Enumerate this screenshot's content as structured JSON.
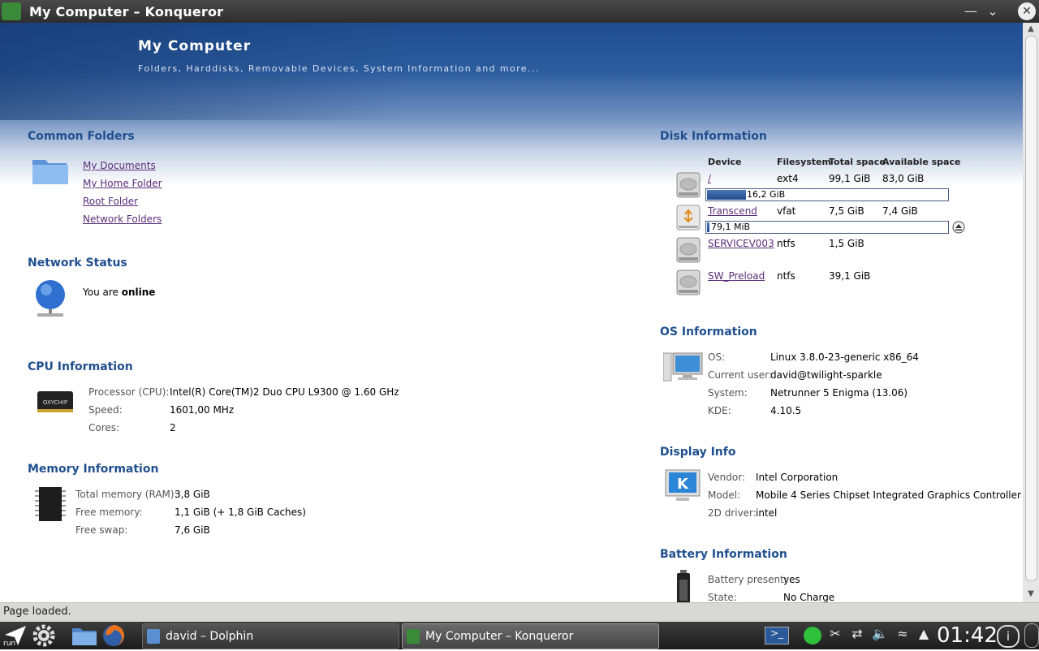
{
  "window": {
    "title": "My Computer – Konqueror"
  },
  "header": {
    "title": "My Computer",
    "subtitle": "Folders, Harddisks, Removable Devices, System Information and more..."
  },
  "common_folders": {
    "heading": "Common Folders",
    "links": [
      "My Documents",
      "My Home Folder",
      "Root Folder",
      "Network Folders"
    ]
  },
  "network": {
    "heading": "Network Status",
    "text_prefix": "You are",
    "status": "online"
  },
  "cpu": {
    "heading": "CPU Information",
    "rows": [
      {
        "label": "Processor (CPU):",
        "value": "Intel(R) Core(TM)2 Duo CPU L9300 @ 1.60 GHz"
      },
      {
        "label": "Speed:",
        "value": "1601,00 MHz"
      },
      {
        "label": "Cores:",
        "value": "2"
      }
    ]
  },
  "memory": {
    "heading": "Memory Information",
    "rows": [
      {
        "label": "Total memory (RAM):",
        "value": "3,8 GiB"
      },
      {
        "label": "Free memory:",
        "value": "1,1 GiB (+ 1,8 GiB Caches)"
      },
      {
        "label": "Free swap:",
        "value": "7,6 GiB"
      }
    ]
  },
  "disk": {
    "heading": "Disk Information",
    "columns": [
      "Device",
      "Filesystem",
      "Total space",
      "Available space"
    ],
    "rows": [
      {
        "device": "/",
        "fs": "ext4",
        "total": "99,1 GiB",
        "avail": "83,0 GiB",
        "used_label": "16,2 GiB",
        "used_fraction": 0.163,
        "icon": "harddisk-icon"
      },
      {
        "device": "Transcend",
        "fs": "vfat",
        "total": "7,5 GiB",
        "avail": "7,4 GiB",
        "used_label": "79,1 MiB",
        "used_fraction": 0.01,
        "icon": "usb-drive-icon"
      },
      {
        "device": "SERVICEV003",
        "fs": "ntfs",
        "total": "1,5 GiB",
        "avail": "",
        "icon": "harddisk-icon"
      },
      {
        "device": "SW_Preload",
        "fs": "ntfs",
        "total": "39,1 GiB",
        "avail": "",
        "icon": "harddisk-icon"
      }
    ]
  },
  "os": {
    "heading": "OS Information",
    "rows": [
      {
        "label": "OS:",
        "value": "Linux 3.8.0-23-generic x86_64"
      },
      {
        "label": "Current user:",
        "value": "david@twilight-sparkle"
      },
      {
        "label": "System:",
        "value": "Netrunner 5 Enigma (13.06)"
      },
      {
        "label": "KDE:",
        "value": "4.10.5"
      }
    ]
  },
  "display": {
    "heading": "Display Info",
    "rows": [
      {
        "label": "Vendor:",
        "value": "Intel Corporation"
      },
      {
        "label": "Model:",
        "value": "Mobile 4 Series Chipset Integrated Graphics Controller"
      },
      {
        "label": "2D driver:",
        "value": "intel"
      }
    ]
  },
  "battery": {
    "heading": "Battery Information",
    "rows": [
      {
        "label": "Battery present:",
        "value": "yes"
      },
      {
        "label": "State:",
        "value": "No Charge"
      }
    ]
  },
  "statusbar": {
    "text": "Page loaded."
  },
  "taskbar": {
    "run_label": "run",
    "tasks": [
      "david – Dolphin",
      "My Computer – Konqueror"
    ],
    "clock": "01:42"
  },
  "colors": {
    "section_heading": "#1f4f8f",
    "link": "#5a2f78",
    "header_blue": "#2d5d9f"
  }
}
